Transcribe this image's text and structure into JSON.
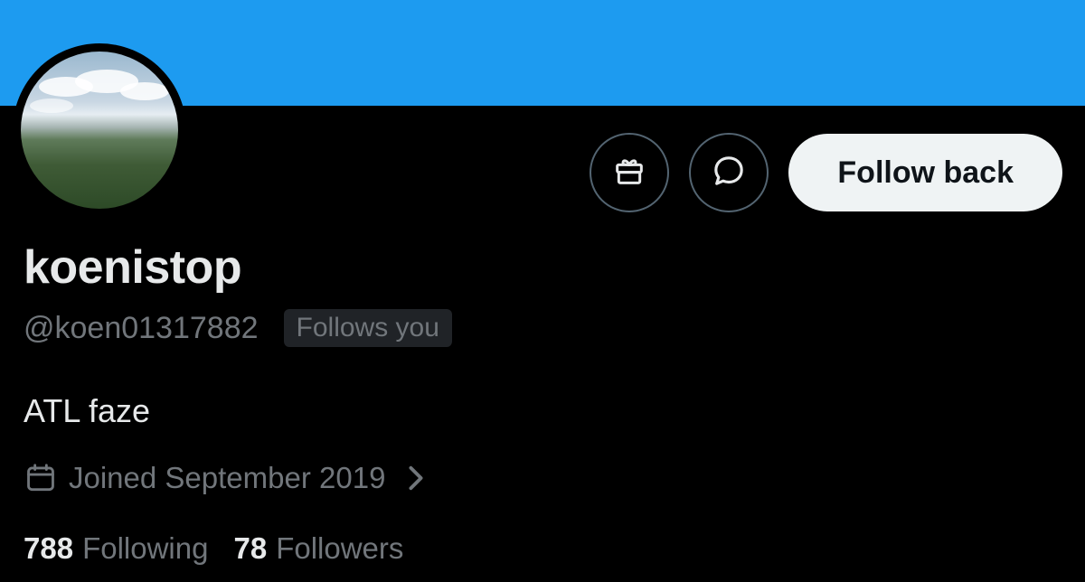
{
  "profile": {
    "display_name": "koenistop",
    "handle": "@koen01317882",
    "follows_you_badge": "Follows you",
    "bio": "ATL faze",
    "joined": "Joined September 2019",
    "following_count": "788",
    "following_label": "Following",
    "followers_count": "78",
    "followers_label": "Followers"
  },
  "actions": {
    "follow_back_label": "Follow back",
    "gift_icon": "gift-icon",
    "message_icon": "message-icon"
  },
  "colors": {
    "banner": "#1d9bf0",
    "background": "#000000",
    "primary_text": "#e7e9ea",
    "secondary_text": "#71767b",
    "follow_button_bg": "#eff3f4"
  }
}
